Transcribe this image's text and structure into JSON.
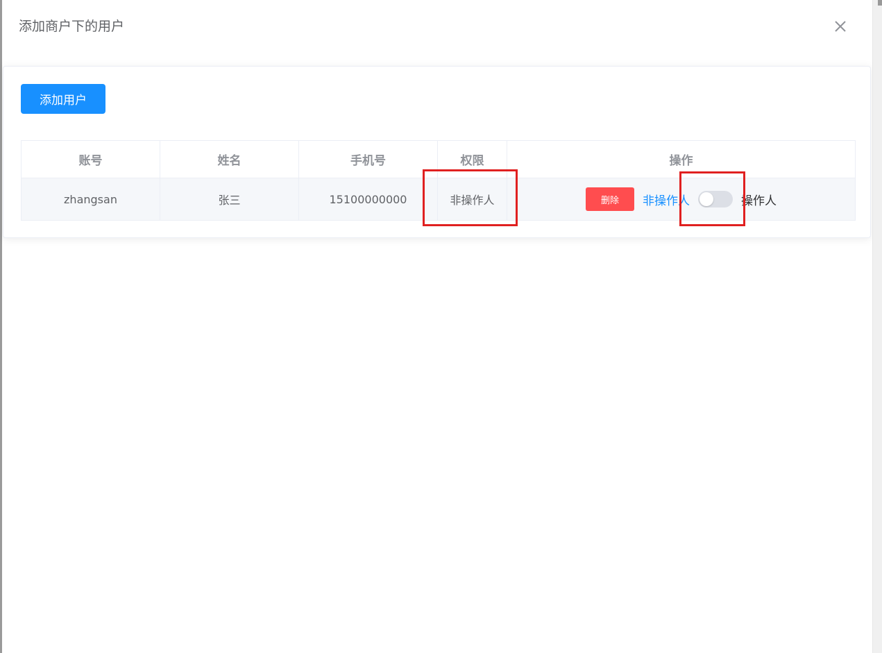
{
  "dialog": {
    "title": "添加商户下的用户",
    "close_icon": "close-icon"
  },
  "toolbar": {
    "add_user_label": "添加用户",
    "add_user_color": "#1890ff"
  },
  "table": {
    "columns": [
      "账号",
      "姓名",
      "手机号",
      "权限",
      "操作"
    ],
    "rows": [
      {
        "account": "zhangsan",
        "name": "张三",
        "phone": "15100000000",
        "permission": "非操作人",
        "actions": {
          "delete_label": "删除",
          "switch_inactive_label": "非操作人",
          "switch_active_label": "操作人",
          "switch_on": false
        }
      }
    ]
  },
  "colors": {
    "delete_button": "#ff4d4f",
    "annotation_box": "#e02020"
  }
}
